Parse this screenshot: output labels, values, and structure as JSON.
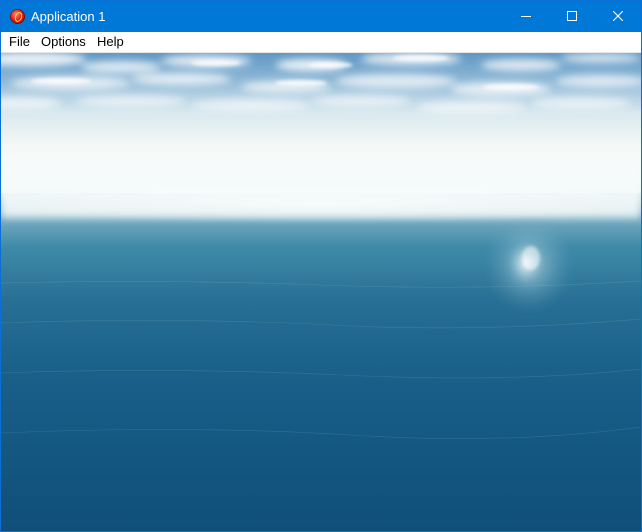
{
  "window": {
    "title": "Application 1",
    "icon": "app-red-orb-icon",
    "controls": [
      "minimize-icon",
      "maximize-icon",
      "close-icon"
    ]
  },
  "menu": {
    "items": [
      {
        "label": "File"
      },
      {
        "label": "Options"
      },
      {
        "label": "Help"
      }
    ]
  },
  "colors": {
    "titlebar": "#0078d7",
    "sky_top": "#5f97c4",
    "horizon": "#f6fbfb",
    "sea_near": "#0f4f7a"
  }
}
